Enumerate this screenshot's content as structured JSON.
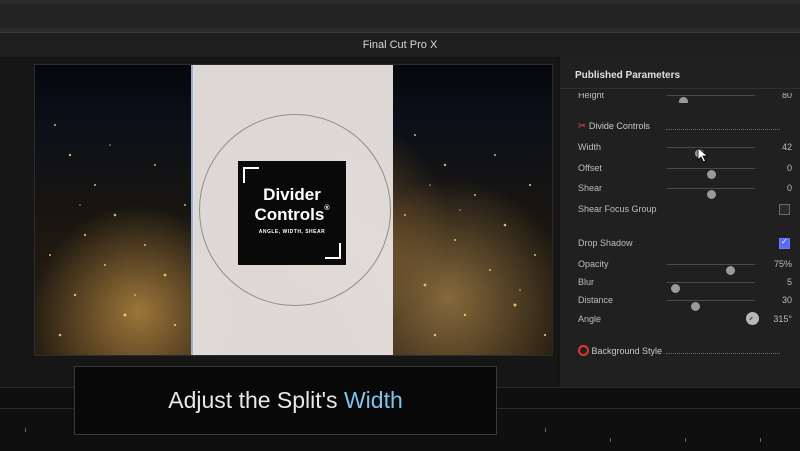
{
  "window": {
    "title": "Final Cut Pro X"
  },
  "viewer": {
    "logo_line1": "Divider",
    "logo_line2": "Controls",
    "logo_registered": "®",
    "logo_sub": "ANGLE, WIDTH, SHEAR"
  },
  "panel": {
    "title": "Published Parameters",
    "height": {
      "label": "Height",
      "value": "80",
      "level": 0.15
    },
    "divide_controls": {
      "label": "Divide Controls",
      "icon": "scissors-icon",
      "width": {
        "label": "Width",
        "value": "42",
        "level": 0.35
      },
      "offset": {
        "label": "Offset",
        "value": "0",
        "level": 0.5
      },
      "shear": {
        "label": "Shear",
        "value": "0",
        "level": 0.5
      },
      "shear_focus": {
        "label": "Shear Focus Group",
        "checked": false
      }
    },
    "drop_shadow": {
      "label": "Drop Shadow",
      "checked": true,
      "opacity": {
        "label": "Opacity",
        "value": "75%",
        "level": 0.75
      },
      "blur": {
        "label": "Blur",
        "value": "5",
        "level": 0.05
      },
      "distance": {
        "label": "Distance",
        "value": "30",
        "level": 0.3
      },
      "angle": {
        "label": "Angle",
        "value": "315°"
      }
    },
    "background_style": {
      "label": "Background Style",
      "icon": "circle-icon"
    }
  },
  "caption": {
    "prefix": "Adjust the Split's ",
    "highlight": "Width"
  },
  "colors": {
    "accent": "#7ec3ea",
    "checkbox_on": "#5a6af0",
    "split_panel": "#e6e1df",
    "background_style_icon": "#d93a2b"
  }
}
